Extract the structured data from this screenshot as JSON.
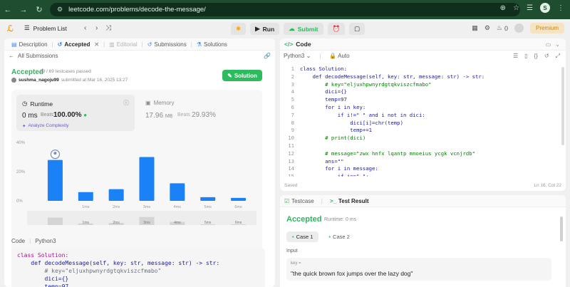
{
  "browser": {
    "url": "leetcode.com/problems/decode-the-message/",
    "profile_initial": "S"
  },
  "appbar": {
    "problem_list": "Problem List",
    "run": "Run",
    "submit": "Submit",
    "notif_count": "0",
    "premium": "Premium"
  },
  "left_tabs": [
    {
      "label": "Description"
    },
    {
      "label": "Accepted"
    },
    {
      "label": "Editorial"
    },
    {
      "label": "Submissions"
    },
    {
      "label": "Solutions"
    }
  ],
  "submission": {
    "back": "All Submissions",
    "status": "Accepted",
    "passed": "69 / 69 testcases passed",
    "user": "sushma_nagoju99",
    "submitted": "submitted at Mar 16, 2025 13:27",
    "solution_button": "Solution"
  },
  "runtime": {
    "label": "Runtime",
    "value": "0 ms",
    "beats_label": "Beats",
    "beats": "100.00%",
    "analyze": "Analyze Complexity"
  },
  "memory": {
    "label": "Memory",
    "value": "17.96",
    "unit": "MB",
    "beats_label": "Beats",
    "beats": "29.93%"
  },
  "chart_data": {
    "type": "bar",
    "categories": [
      "0ms",
      "1ms",
      "2ms",
      "3ms",
      "4ms",
      "5ms",
      "6ms"
    ],
    "values": [
      28,
      6,
      8,
      30,
      12,
      2.5,
      2
    ],
    "ylim": [
      0,
      40
    ],
    "yticks": [
      "40%",
      "20%",
      "0%"
    ],
    "tick_labels": [
      "1ms",
      "2ms",
      "3ms",
      "4ms",
      "5ms",
      "6ms"
    ],
    "nav_labels": [
      "1ms",
      "2ms",
      "3ms",
      "4ms",
      "5ms",
      "6ms"
    ],
    "bar_color": "#1a82f6"
  },
  "code_section": {
    "label": "Code",
    "lang": "Python3"
  },
  "code_preview": [
    "class Solution:",
    "    def decodeMessage(self, key: str, message: str) -> str:",
    "        # key=\"eljuxhpwnyrdgtqkviszcfmabo\"",
    "        dici={}",
    "        temp=97"
  ],
  "editor": {
    "title": "Code",
    "lang": "Python3",
    "mode": "Auto",
    "saved": "Saved",
    "cursor": "Ln 16, Col 22",
    "lines": [
      "class Solution:",
      "    def decodeMessage(self, key: str, message: str) -> str:",
      "        # key=\"eljuxhpwnyrdgtqkviszcfmabo\"",
      "        dici={}",
      "        temp=97",
      "        for i in key:",
      "            if i!=\" \" and i not in dici:",
      "                dici[i]=chr(temp)",
      "                temp+=1",
      "        # print(dici)",
      "",
      "        # message=\"zwx hnfx lqantp mnoeius ycgk vcnjrdb\"",
      "        ans=\"\"",
      "        for i in message:",
      "            if i==\" \":",
      "                ans+=\" \""
    ]
  },
  "test": {
    "tab_testcase": "Testcase",
    "tab_result": "Test Result",
    "status": "Accepted",
    "runtime": "Runtime: 0 ms",
    "case1": "Case 1",
    "case2": "Case 2",
    "input_label": "Input",
    "key_label": "key =",
    "key_value": "\"the quick brown fox jumps over the lazy dog\""
  }
}
